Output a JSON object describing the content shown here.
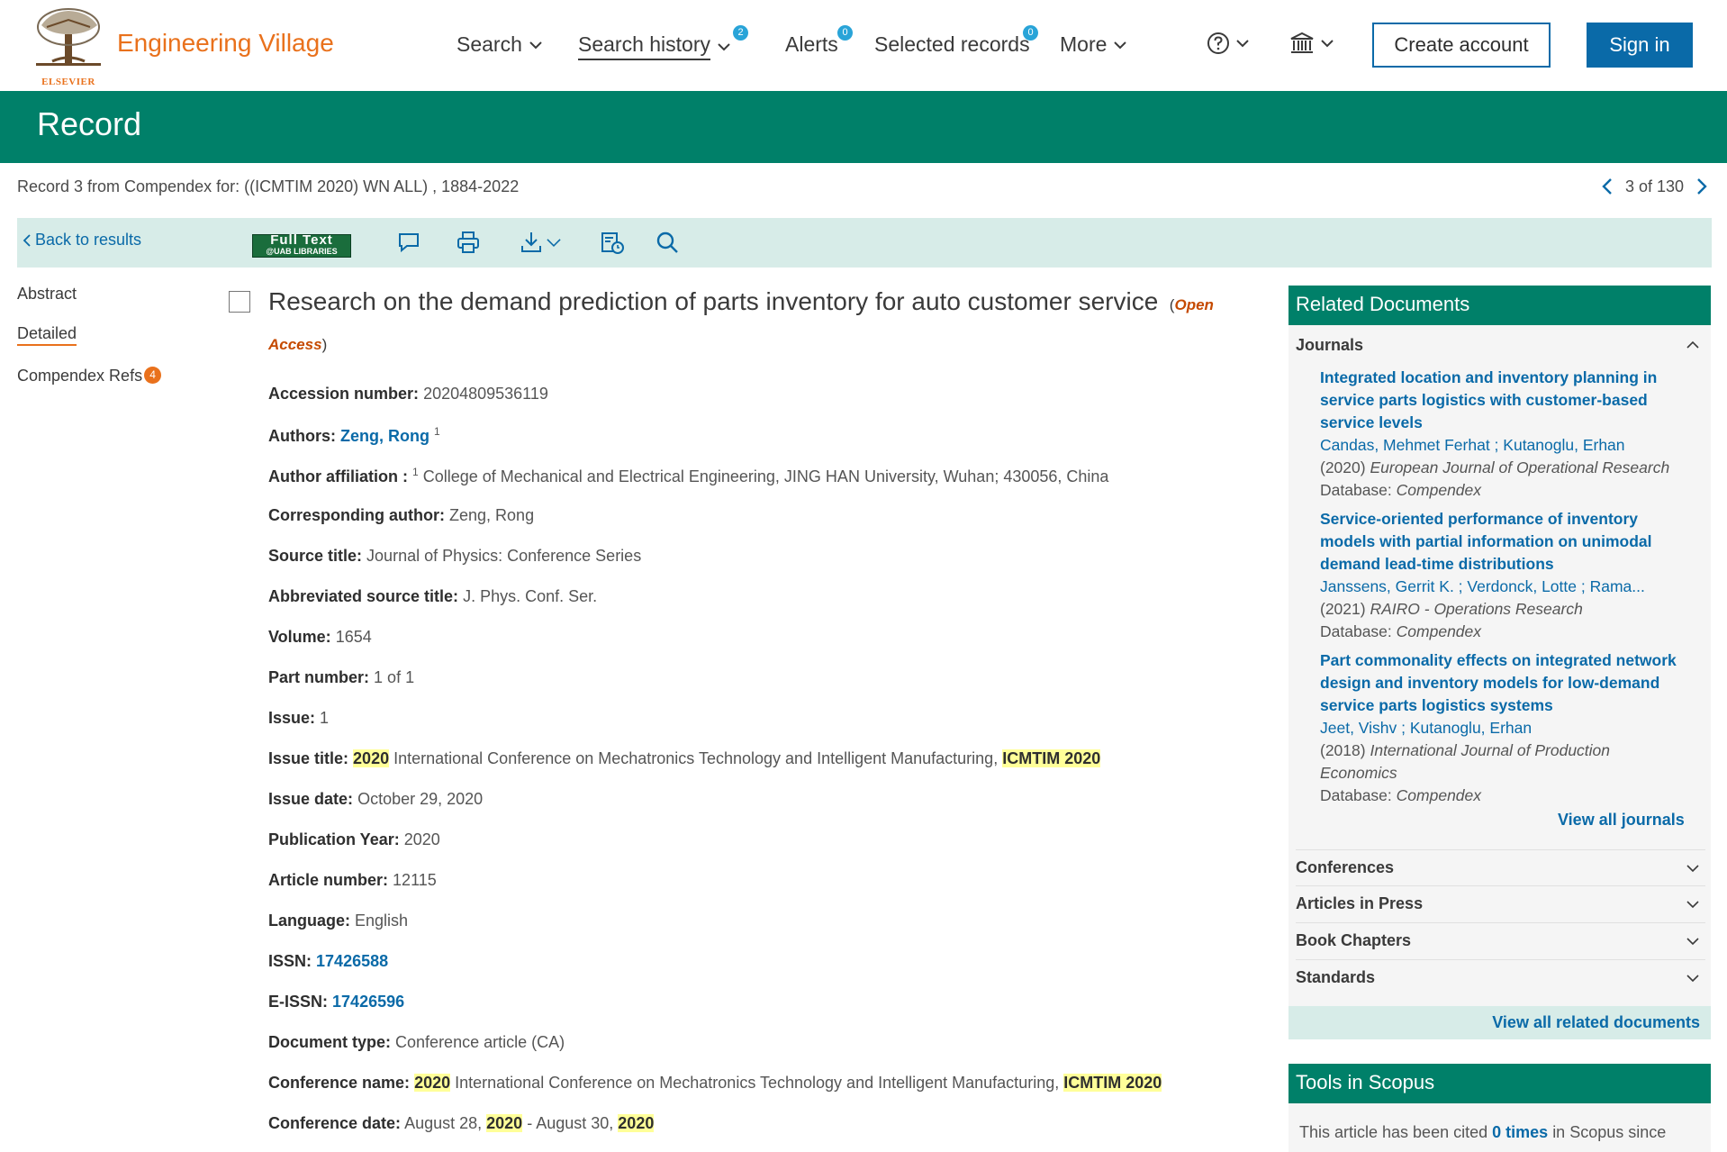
{
  "brand": {
    "publisher": "ELSEVIER",
    "product": "Engineering Village"
  },
  "nav": {
    "search": "Search",
    "search_history": "Search history",
    "search_history_count": "2",
    "alerts": "Alerts",
    "alerts_count": "0",
    "selected_records": "Selected records",
    "selected_records_count": "0",
    "more": "More",
    "create_account": "Create account",
    "sign_in": "Sign in"
  },
  "page_title": "Record",
  "record_info": "Record 3 from Compendex for: ((ICMTIM 2020) WN ALL) , 1884-2022",
  "pager": "3 of 130",
  "toolbar": {
    "back": "Back to results",
    "fulltext_line1": "Full Text",
    "fulltext_line2": "@UAB LIBRARIES"
  },
  "leftnav": {
    "abstract": "Abstract",
    "detailed": "Detailed",
    "refs": "Compendex Refs",
    "refs_count": "4"
  },
  "record": {
    "title": "Research on the demand prediction of parts inventory for auto customer service",
    "open_access": "Open Access",
    "accession_label": "Accession number:",
    "accession": "20204809536119",
    "authors_label": "Authors:",
    "author": "Zeng, Rong",
    "author_sup": "1",
    "affiliation_label": "Author affiliation :",
    "affiliation_sup": "1",
    "affiliation": "College of Mechanical and Electrical Engineering, JING HAN University, Wuhan; 430056, China",
    "corresponding_label": "Corresponding author:",
    "corresponding": "Zeng, Rong",
    "source_label": "Source title:",
    "source": "Journal of Physics: Conference Series",
    "abbrev_label": "Abbreviated source title:",
    "abbrev": "J. Phys. Conf. Ser.",
    "volume_label": "Volume:",
    "volume": "1654",
    "part_label": "Part number:",
    "part": "1 of 1",
    "issue_label": "Issue:",
    "issue": "1",
    "issue_title_label": "Issue title:",
    "issue_title_year": "2020",
    "issue_title_middle": "International Conference on Mechatronics Technology and Intelligent Manufacturing,",
    "issue_title_hl": "ICMTIM 2020",
    "issue_date_label": "Issue date:",
    "issue_date": "October 29, 2020",
    "pub_year_label": "Publication Year:",
    "pub_year": "2020",
    "article_label": "Article number:",
    "article": "12115",
    "language_label": "Language:",
    "language": "English",
    "issn_label": "ISSN:",
    "issn": "17426588",
    "eissn_label": "E-ISSN:",
    "eissn": "17426596",
    "doctype_label": "Document type:",
    "doctype": "Conference article (CA)",
    "conf_name_label": "Conference name:",
    "conf_name_year": "2020",
    "conf_name_middle": "International Conference on Mechatronics Technology and Intelligent Manufacturing,",
    "conf_name_hl": "ICMTIM 2020",
    "conf_date_label": "Conference date:",
    "conf_date_start": "August 28,",
    "conf_date_year1": "2020",
    "conf_date_mid": "- August 30,",
    "conf_date_year2": "2020"
  },
  "related": {
    "heading": "Related Documents",
    "journals": "Journals",
    "docs": [
      {
        "title": "Integrated location and inventory planning in service parts logistics with customer-based service levels",
        "authors": "Candas, Mehmet Ferhat ; Kutanoglu, Erhan",
        "year": "(2020)",
        "source": "European Journal of Operational Research",
        "db_label": "Database:",
        "db": "Compendex"
      },
      {
        "title": "Service-oriented performance of inventory models with partial information on unimodal demand lead-time distributions",
        "authors": "Janssens, Gerrit K. ; Verdonck, Lotte ; Rama...",
        "year": "(2021)",
        "source": "RAIRO - Operations Research",
        "db_label": "Database:",
        "db": "Compendex"
      },
      {
        "title": "Part commonality effects on integrated network design and inventory models for low-demand service parts logistics systems",
        "authors": "Jeet, Vishv ; Kutanoglu, Erhan",
        "year": "(2018)",
        "source": "International Journal of Production Economics",
        "db_label": "Database:",
        "db": "Compendex"
      }
    ],
    "view_journals": "View all journals",
    "conferences": "Conferences",
    "articles_in_press": "Articles in Press",
    "book_chapters": "Book Chapters",
    "standards": "Standards",
    "view_all": "View all related documents"
  },
  "scopus": {
    "heading": "Tools in Scopus",
    "text_before": "This article has been cited",
    "cited": "0 times",
    "text_after": "in Scopus since"
  },
  "colors": {
    "brand_orange": "#e9711c",
    "header_green": "#008069",
    "link_blue": "#0a6aa8",
    "toolbar_bg": "#d7ece8",
    "highlight": "#ffff99"
  },
  "icons": [
    "tree-logo",
    "chevron-down-icon",
    "help-icon",
    "institution-icon",
    "chevron-left-icon",
    "chevron-right-icon",
    "comment-icon",
    "print-icon",
    "download-icon",
    "save-history-icon",
    "search-icon",
    "chevron-up-icon"
  ]
}
